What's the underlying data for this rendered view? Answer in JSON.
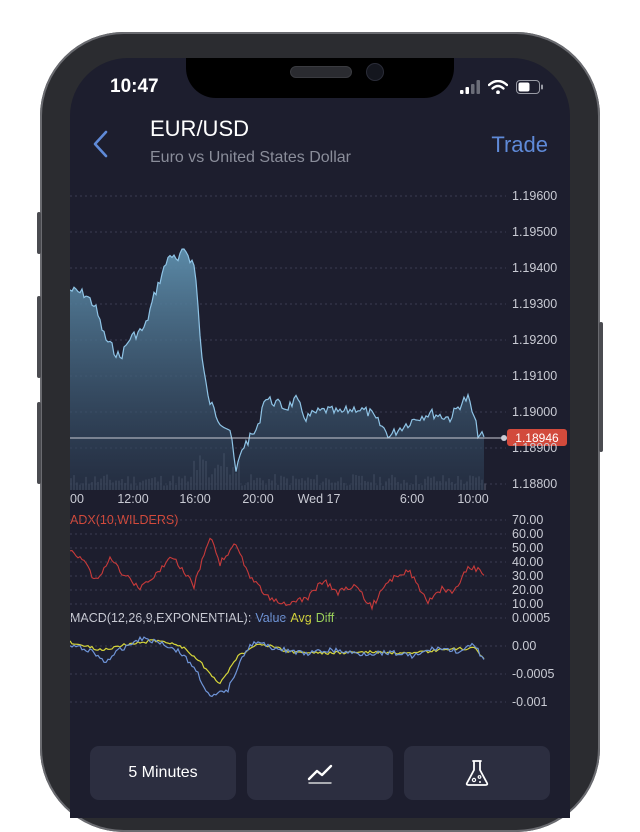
{
  "status": {
    "time": "10:47"
  },
  "header": {
    "title": "EUR/USD",
    "subtitle": "Euro vs United States Dollar",
    "trade_label": "Trade",
    "back_icon": "chevron-left-icon"
  },
  "price_chart": {
    "y_ticks": [
      "1.19600",
      "1.19500",
      "1.19400",
      "1.19300",
      "1.19200",
      "1.19100",
      "1.19000",
      "1.18900",
      "1.18800"
    ],
    "x_ticks": [
      "00",
      "12:00",
      "16:00",
      "20:00",
      "Wed 17",
      "6:00",
      "10:00"
    ],
    "current_price": "1.18946",
    "ylim": [
      1.188,
      1.196
    ]
  },
  "adx": {
    "label": "ADX(10,WILDERS)",
    "y_ticks": [
      "70.00",
      "60.00",
      "50.00",
      "40.00",
      "30.00",
      "20.00",
      "10.00"
    ]
  },
  "macd": {
    "label_main": "MACD(12,26,9,EXPONENTIAL):",
    "label_value": "Value",
    "label_avg": "Avg",
    "label_diff": "Diff",
    "y_ticks": [
      "0.0005",
      "0.00",
      "-0.0005",
      "-0.001"
    ]
  },
  "colors": {
    "accent": "#5f8ad8",
    "price_line": "#8fc4e6",
    "adx_line": "#c83a3a",
    "macd_value": "#6f95d8",
    "macd_avg": "#d6d63a",
    "badge": "#d24a3c"
  },
  "toolbar": {
    "interval_label": "5 Minutes",
    "chart_type_icon": "line-chart-icon",
    "studies_icon": "flask-icon"
  }
}
